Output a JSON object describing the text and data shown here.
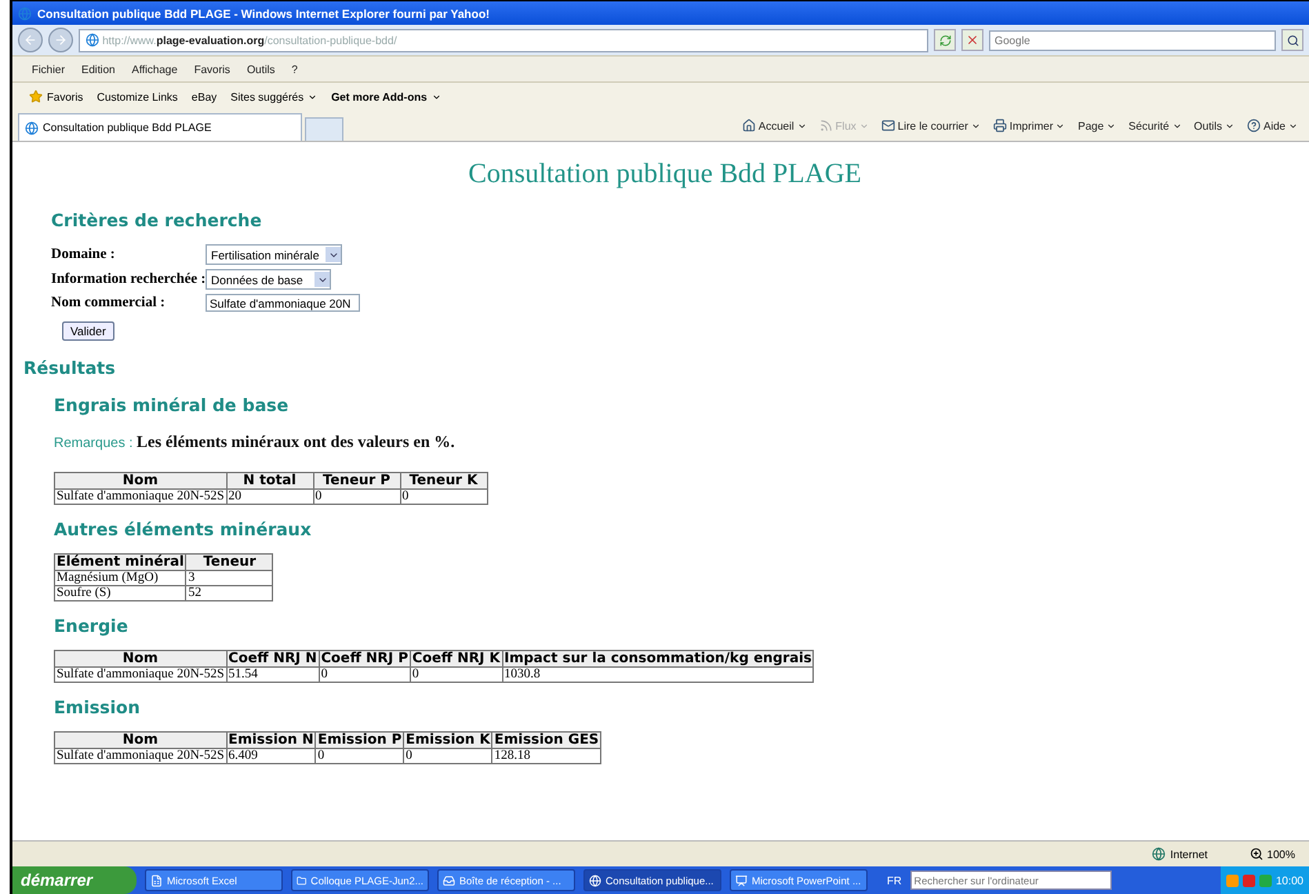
{
  "window": {
    "title": "Consultation publique Bdd PLAGE - Windows Internet Explorer fourni par Yahoo!"
  },
  "address_bar": {
    "url_prefix": "http://www.",
    "url_domain": "plage-evaluation.org",
    "url_path": "/consultation-publique-bdd/",
    "search_placeholder": "Google"
  },
  "menu": [
    "Fichier",
    "Edition",
    "Affichage",
    "Favoris",
    "Outils",
    "?"
  ],
  "favorites_bar": {
    "favorites": "Favoris",
    "links": [
      {
        "label": "Customize Links",
        "has_menu": false,
        "bold": false
      },
      {
        "label": "eBay",
        "has_menu": false,
        "bold": false
      },
      {
        "label": "Sites suggérés",
        "has_menu": true,
        "bold": false
      },
      {
        "label": "Get more Add-ons",
        "has_menu": true,
        "bold": true
      }
    ]
  },
  "tabs": [
    {
      "label": "Consultation publique Bdd PLAGE",
      "selected": true
    }
  ],
  "command_bar": [
    {
      "label": "Accueil",
      "disabled": false
    },
    {
      "label": "Flux",
      "disabled": true
    },
    {
      "label": "Lire le courrier",
      "disabled": false
    },
    {
      "label": "Imprimer",
      "disabled": false
    },
    {
      "label": "Page",
      "disabled": false
    },
    {
      "label": "Sécurité",
      "disabled": false
    },
    {
      "label": "Outils",
      "disabled": false
    },
    {
      "label": "Aide",
      "disabled": false
    }
  ],
  "page": {
    "title": "Consultation publique Bdd PLAGE",
    "criteria": {
      "heading": "Critères de recherche",
      "fields": [
        {
          "kind": "select",
          "label": "Domaine :",
          "value": "Fertilisation minérale"
        },
        {
          "kind": "select",
          "label": "Information recherchée :",
          "value": "Données de base"
        },
        {
          "kind": "text",
          "label": "Nom commercial :",
          "value": "Sulfate d'ammoniaque 20N"
        }
      ],
      "button": "Valider"
    },
    "results_heading": "Résultats",
    "sections": [
      {
        "heading": "Engrais minéral de base",
        "remark_label": "Remarques :",
        "remark": "Les éléments minéraux ont des valeurs en %.",
        "columns": [
          "Nom",
          "N total",
          "Teneur P",
          "Teneur K"
        ],
        "rows": [
          [
            "Sulfate d'ammoniaque 20N-52S",
            "20",
            "0",
            "0"
          ]
        ]
      },
      {
        "heading": "Autres éléments minéraux",
        "columns": [
          "Elément minéral",
          "Teneur"
        ],
        "rows": [
          [
            "Magnésium (MgO)",
            "3"
          ],
          [
            "Soufre (S)",
            "52"
          ]
        ]
      },
      {
        "heading": "Energie",
        "columns": [
          "Nom",
          "Coeff NRJ N",
          "Coeff NRJ P",
          "Coeff NRJ K",
          "Impact sur la consommation/kg engrais"
        ],
        "rows": [
          [
            "Sulfate d'ammoniaque 20N-52S",
            "51.54",
            "0",
            "0",
            "1030.8"
          ]
        ]
      },
      {
        "heading": "Emission",
        "columns": [
          "Nom",
          "Emission N",
          "Emission P",
          "Emission K",
          "Emission GES"
        ],
        "rows": [
          [
            "Sulfate d'ammoniaque 20N-52S",
            "6.409",
            "0",
            "0",
            "128.18"
          ]
        ]
      }
    ]
  },
  "status_bar": {
    "zone": "Internet",
    "zoom": "100%"
  },
  "taskbar": {
    "start": "démarrer",
    "tasks": [
      {
        "label": "Microsoft Excel",
        "selected": false
      },
      {
        "label": "Colloque PLAGE-Jun2...",
        "selected": false
      },
      {
        "label": "Boîte de réception - ...",
        "selected": false
      },
      {
        "label": "Consultation publique...",
        "selected": true
      },
      {
        "label": "Microsoft PowerPoint ...",
        "selected": false
      }
    ],
    "language": "FR",
    "search_placeholder": "Rechercher sur l'ordinateur",
    "clock": "10:00"
  }
}
